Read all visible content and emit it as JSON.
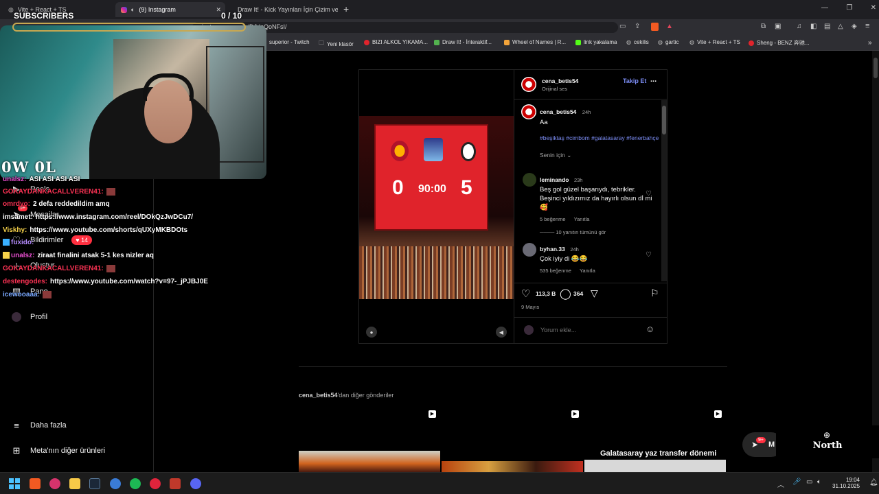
{
  "browser": {
    "tabs": [
      {
        "label": "Vite + React + TS"
      },
      {
        "label": "(9) Instagram"
      },
      {
        "label": "Draw It! - Kick Yayınları İçin Çizim ve"
      }
    ],
    "new_tab": "+",
    "url": "instagram.com/p/DJdoQoNFsI/",
    "window_controls": [
      "—",
      "❐",
      "✕"
    ],
    "bookmarks": [
      {
        "label": "superior - Twitch",
        "color": "#9146ff"
      },
      {
        "label": "Yeni klasör",
        "color": "#cfcfcf"
      },
      {
        "label": "BIZI ALKOL YIKAMA...",
        "color": "#e0242c"
      },
      {
        "label": "Draw It! - İnteraktif...",
        "color": "#53b24f"
      },
      {
        "label": "Wheel of Names | R...",
        "color": "#f2a33a"
      },
      {
        "label": "link yakalama",
        "color": "#53fc18"
      },
      {
        "label": "cekilis",
        "color": "#bbbbbb"
      },
      {
        "label": "gartic",
        "color": "#bbbbbb"
      },
      {
        "label": "Vite + React + TS",
        "color": "#bbbbbb"
      },
      {
        "label": "Sheng - BENZ 奔驰...",
        "color": "#e0242c"
      }
    ]
  },
  "overlay": {
    "subscribers_label": "SUBSCRIBERS",
    "subscribers_count": "0 / 10",
    "logo_text": "0W 0L",
    "chat": [
      {
        "name": "unalsz:",
        "name_color": "#e94fd0",
        "text": "ASI ASI ASI ASI"
      },
      {
        "name": "GOKAYDANKACALLVEREN41:",
        "name_color": "#ff3355",
        "text": ""
      },
      {
        "name": "omrdyo:",
        "name_color": "#ff3355",
        "text": "2 defa reddedildim amq"
      },
      {
        "name": "imsamet:",
        "name_color": "#ffffff",
        "text": "https://www.instagram.com/reel/DOkQzJwDCu7/"
      },
      {
        "name": "Viskhy:",
        "name_color": "#f7d24a",
        "text": "https://www.youtube.com/shorts/qUXyMKBDOts"
      },
      {
        "name": "fuxido:",
        "name_color": "#b58bff",
        "text": ""
      },
      {
        "name": "unalsz:",
        "name_color": "#e94fd0",
        "text": "ziraat finalini atsak 5-1 kes nizler aq"
      },
      {
        "name": "GOKAYDANKACALLVEREN41:",
        "name_color": "#ff3355",
        "text": ""
      },
      {
        "name": "destengodes:",
        "name_color": "#ff3355",
        "text": "https://www.youtube.com/watch?v=97-_jPJBJ0E"
      },
      {
        "name": "icewooaaa:",
        "name_color": "#79a8ff",
        "text": ""
      }
    ]
  },
  "sidebar": {
    "items": [
      {
        "label": "Reels",
        "icon": "reels-icon"
      },
      {
        "label": "Mesajlar",
        "icon": "messages-icon"
      },
      {
        "label": "Bildirimler",
        "icon": "heart-icon"
      },
      {
        "label": "Oluştur",
        "icon": "plus-icon"
      },
      {
        "label": "Pano",
        "icon": "dashboard-icon"
      },
      {
        "label": "Profil",
        "icon": "avatar-icon"
      }
    ],
    "messages_badge": "9+",
    "notifications_badge": "14",
    "more": "Daha fazla",
    "meta": "Meta'nın diğer ürünleri"
  },
  "post": {
    "author": "cena_betis54",
    "audio": "Orijinal ses",
    "follow": "Takip Et",
    "more": "...",
    "scoreboard": {
      "home": "0",
      "time": "90:00",
      "away": "5"
    },
    "caption": {
      "user": "cena_betis54",
      "time": "24h",
      "text": "Aa",
      "hashtags": "#beşiktaş #cimbom #galatasaray #fenerbahçe"
    },
    "for_you": "Senin için",
    "comments": [
      {
        "user": "leminando",
        "time": "23h",
        "text": "Beş gol güzel başarıydı, tebrikler. Beşinci yıldızımız da hayırlı olsun dİ mi 🥰",
        "likes": "5 beğenme",
        "reply": "Yanıtla",
        "view_replies": "10 yanıtın tümünü gör"
      },
      {
        "user": "byhan.33",
        "time": "24h",
        "text": "Çok iyiy di 😂😂",
        "likes": "535 beğenme",
        "reply": "Yanıtla"
      }
    ],
    "like_count": "113,3 B",
    "comment_count": "364",
    "date": "9 Mayıs",
    "comment_placeholder": "Yorum ekle..."
  },
  "more_posts": {
    "title_user": "cena_betis54",
    "title_rest": "'dan diğer gönderiler",
    "thumb3_caption": "Galatasaray yaz transfer dönemi"
  },
  "messages_pill": {
    "badge": "9+",
    "label": "M"
  },
  "north": {
    "label": "North"
  },
  "taskbar": {
    "time": "19:04",
    "date": "31.10.2025"
  }
}
